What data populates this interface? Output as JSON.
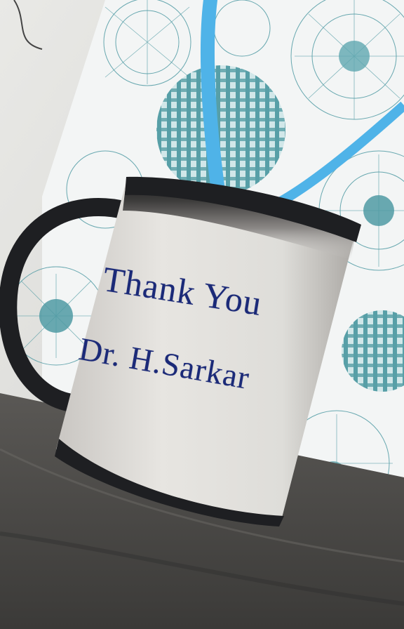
{
  "mug": {
    "line1": "Thank You",
    "line2": "Dr. H.Sarkar",
    "text_color": "#1b2a78"
  },
  "colors": {
    "ribbon": "#4fb3e8",
    "pattern_teal": "#4f9aa3",
    "mug_rim": "#1e1f22",
    "table": "#4a4846"
  }
}
